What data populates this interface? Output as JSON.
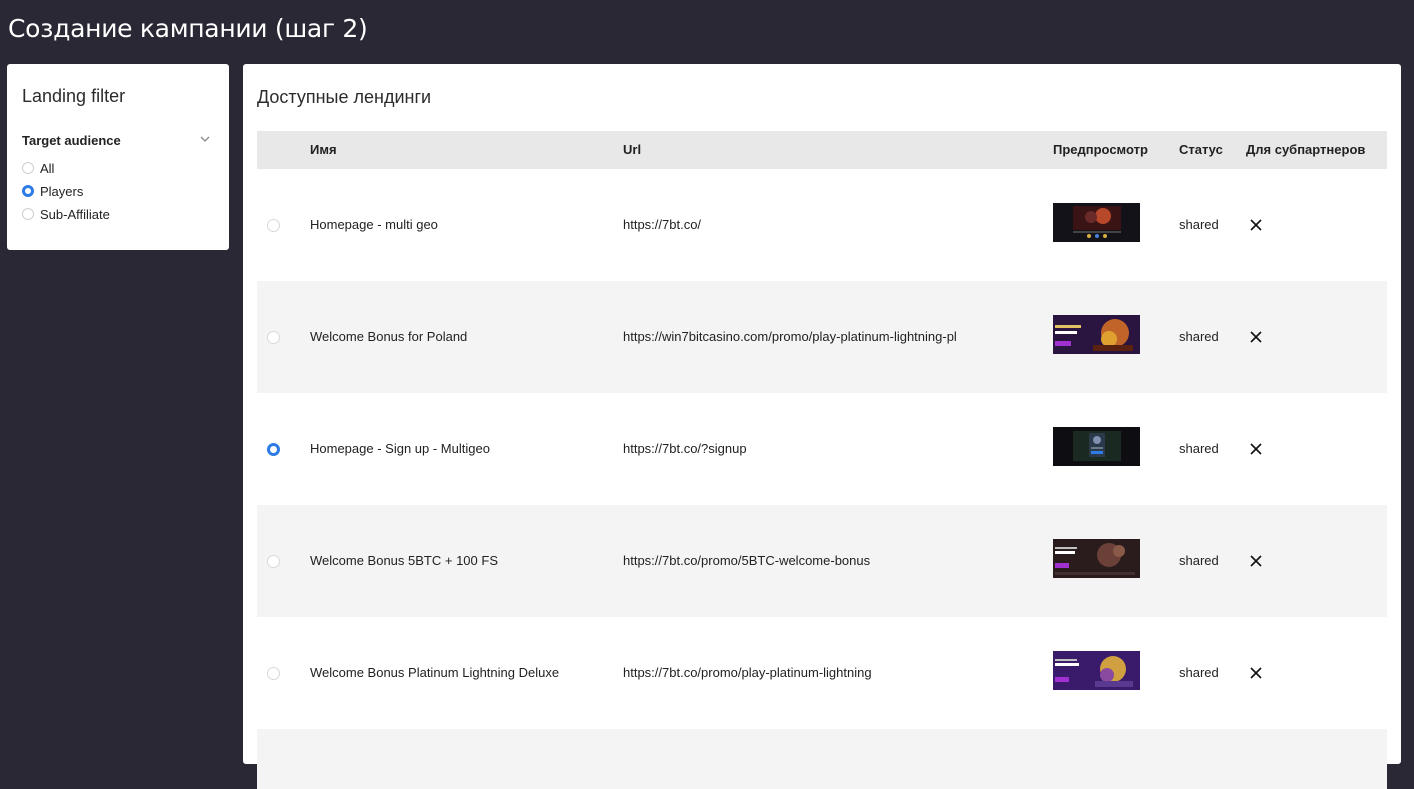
{
  "page": {
    "title": "Создание кампании (шаг 2)"
  },
  "filter": {
    "title": "Landing filter",
    "group_label": "Target audience",
    "options": [
      {
        "label": "All",
        "checked": false
      },
      {
        "label": "Players",
        "checked": true
      },
      {
        "label": "Sub-Affiliate",
        "checked": false
      }
    ]
  },
  "landings": {
    "title": "Доступные лендинги",
    "columns": {
      "name": "Имя",
      "url": "Url",
      "preview": "Предпросмотр",
      "status": "Статус",
      "subpartners": "Для субпартнеров"
    },
    "rows": [
      {
        "name": "Homepage - multi geo",
        "url": "https://7bt.co/",
        "status": "shared",
        "selected": false,
        "preview_theme": "red-dark"
      },
      {
        "name": "Welcome Bonus for Poland",
        "url": "https://win7bitcasino.com/promo/play-platinum-lightning-pl",
        "status": "shared",
        "selected": false,
        "preview_theme": "purple-gold"
      },
      {
        "name": "Homepage - Sign up - Multigeo",
        "url": "https://7bt.co/?signup",
        "status": "shared",
        "selected": true,
        "preview_theme": "dark-green"
      },
      {
        "name": "Welcome Bonus 5BTC + 100 FS",
        "url": "https://7bt.co/promo/5BTC-welcome-bonus",
        "status": "shared",
        "selected": false,
        "preview_theme": "dark-brown"
      },
      {
        "name": "Welcome Bonus Platinum Lightning Deluxe",
        "url": "https://7bt.co/promo/play-platinum-lightning",
        "status": "shared",
        "selected": false,
        "preview_theme": "purple-gold"
      }
    ]
  },
  "colors": {
    "background": "#2a2834",
    "accent_radio": "#2d7be5",
    "header_row": "#e8e8e8",
    "alt_row": "#f4f4f4"
  }
}
